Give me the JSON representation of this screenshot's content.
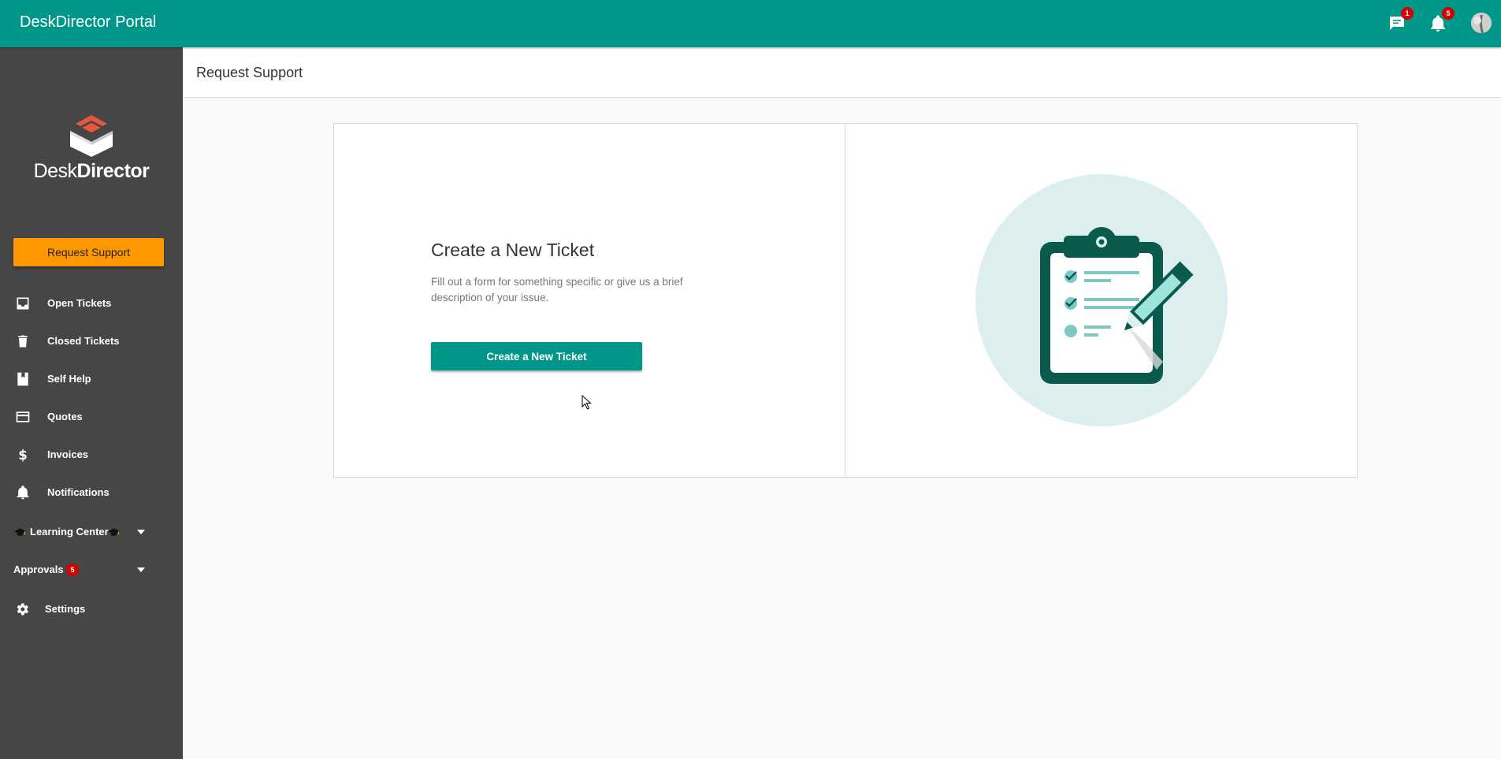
{
  "app": {
    "title": "DeskDirector Portal"
  },
  "topbar": {
    "chat_badge": "1",
    "notification_badge": "5"
  },
  "logo": {
    "text_light": "Desk",
    "text_bold": "Director"
  },
  "sidebar": {
    "request_button": "Request Support",
    "items": [
      {
        "label": "Open Tickets",
        "icon": "inbox-icon"
      },
      {
        "label": "Closed Tickets",
        "icon": "trash-icon"
      },
      {
        "label": "Self Help",
        "icon": "book-icon"
      },
      {
        "label": "Quotes",
        "icon": "credit-card-icon"
      },
      {
        "label": "Invoices",
        "icon": "dollar-icon"
      },
      {
        "label": "Notifications",
        "icon": "bell-icon"
      },
      {
        "label": "Learning Center",
        "icon": "graduation-cap-icon"
      },
      {
        "label": "Approvals",
        "badge": "5"
      },
      {
        "label": "Settings",
        "icon": "gear-icon"
      }
    ]
  },
  "main": {
    "page_title": "Request Support",
    "card": {
      "heading": "Create a New Ticket",
      "description": "Fill out a form for something specific or give us a brief description of your issue.",
      "button": "Create a New Ticket"
    }
  },
  "colors": {
    "primary": "#00978a",
    "accent": "#ff9800",
    "sidebar": "#464646",
    "badge": "#d50000"
  }
}
